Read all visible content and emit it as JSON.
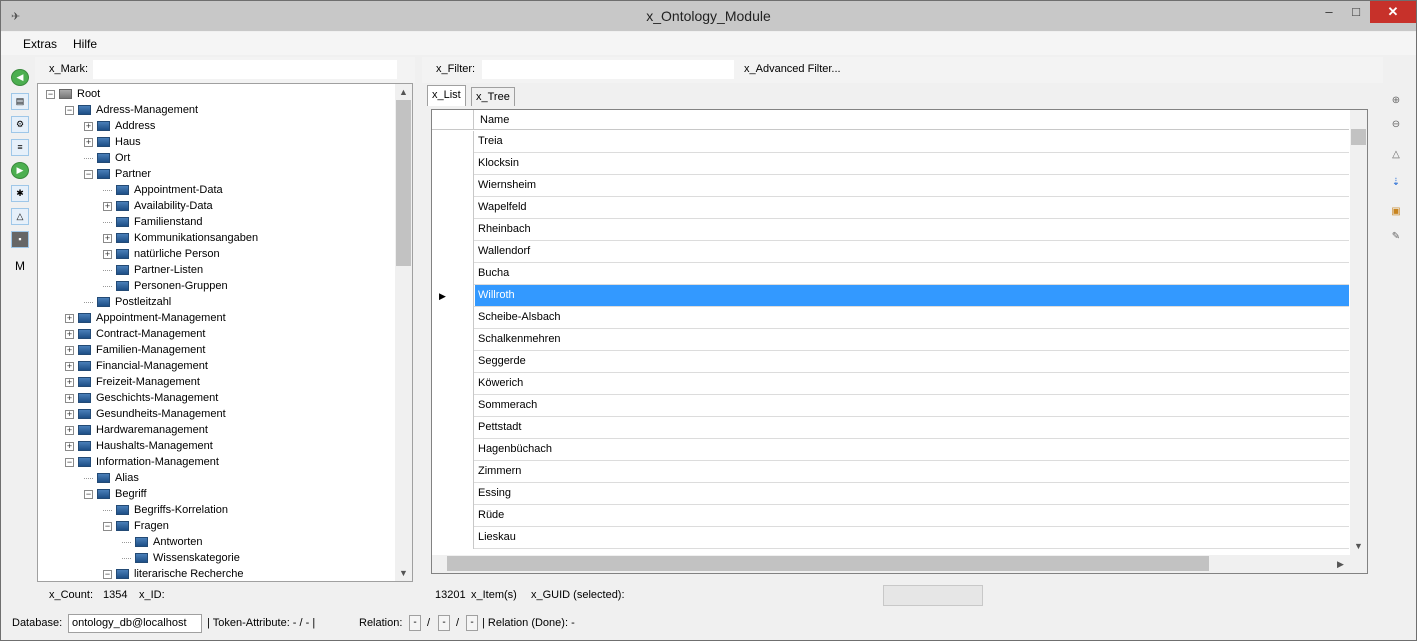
{
  "window": {
    "title": "x_Ontology_Module",
    "min": "–",
    "max": "□",
    "close": "✕"
  },
  "menu": [
    "Extras",
    "Hilfe"
  ],
  "left_toolbar": [
    "arrow-left-icon",
    "db-icon",
    "graph-icon",
    "tree-icon",
    "arrow-right-icon",
    "network-icon",
    "relation-icon",
    "image-icon",
    "M"
  ],
  "mark_label": "x_Mark:",
  "tree": [
    {
      "label": "Root",
      "level": 0,
      "exp": "−"
    },
    {
      "label": "Adress-Management",
      "level": 1,
      "exp": "−"
    },
    {
      "label": "Address",
      "level": 2,
      "exp": "+"
    },
    {
      "label": "Haus",
      "level": 2,
      "exp": "+"
    },
    {
      "label": "Ort",
      "level": 2,
      "exp": ""
    },
    {
      "label": "Partner",
      "level": 2,
      "exp": "−"
    },
    {
      "label": "Appointment-Data",
      "level": 3,
      "exp": ""
    },
    {
      "label": "Availability-Data",
      "level": 3,
      "exp": "+"
    },
    {
      "label": "Familienstand",
      "level": 3,
      "exp": ""
    },
    {
      "label": "Kommunikationsangaben",
      "level": 3,
      "exp": "+"
    },
    {
      "label": "natürliche Person",
      "level": 3,
      "exp": "+"
    },
    {
      "label": "Partner-Listen",
      "level": 3,
      "exp": ""
    },
    {
      "label": "Personen-Gruppen",
      "level": 3,
      "exp": ""
    },
    {
      "label": "Postleitzahl",
      "level": 2,
      "exp": ""
    },
    {
      "label": "Appointment-Management",
      "level": 1,
      "exp": "+"
    },
    {
      "label": "Contract-Management",
      "level": 1,
      "exp": "+"
    },
    {
      "label": "Familien-Management",
      "level": 1,
      "exp": "+"
    },
    {
      "label": "Financial-Management",
      "level": 1,
      "exp": "+"
    },
    {
      "label": "Freizeit-Management",
      "level": 1,
      "exp": "+"
    },
    {
      "label": "Geschichts-Management",
      "level": 1,
      "exp": "+"
    },
    {
      "label": "Gesundheits-Management",
      "level": 1,
      "exp": "+"
    },
    {
      "label": "Hardwaremanagement",
      "level": 1,
      "exp": "+"
    },
    {
      "label": "Haushalts-Management",
      "level": 1,
      "exp": "+"
    },
    {
      "label": "Information-Management",
      "level": 1,
      "exp": "−"
    },
    {
      "label": "Alias",
      "level": 2,
      "exp": ""
    },
    {
      "label": "Begriff",
      "level": 2,
      "exp": "−"
    },
    {
      "label": "Begriffs-Korrelation",
      "level": 3,
      "exp": ""
    },
    {
      "label": "Fragen",
      "level": 3,
      "exp": "−"
    },
    {
      "label": "Antworten",
      "level": 4,
      "exp": ""
    },
    {
      "label": "Wissenskategorie",
      "level": 4,
      "exp": ""
    },
    {
      "label": "literarische Recherche",
      "level": 3,
      "exp": "−"
    }
  ],
  "left_status": {
    "count_label": "x_Count:",
    "count": "1354",
    "id_label": "x_ID:"
  },
  "filter_label": "x_Filter:",
  "advanced_filter": "x_Advanced Filter...",
  "tabs": [
    "x_List",
    "x_Tree"
  ],
  "grid": {
    "header": "Name",
    "rows": [
      "Treia",
      "Klocksin",
      "Wiernsheim",
      "Wapelfeld",
      "Rheinbach",
      "Wallendorf",
      "Bucha",
      "Willroth",
      "Scheibe-Alsbach",
      "Schalkenmehren",
      "Seggerde",
      "Köwerich",
      "Sommerach",
      "Pettstadt",
      "Hagenbüchach",
      "Zimmern",
      "Essing",
      "Rüde",
      "Lieskau"
    ],
    "selected": 7
  },
  "right_status": {
    "count": "13201",
    "items_label": "x_Item(s)",
    "guid_label": "x_GUID (selected):"
  },
  "right_toolbar": [
    "add-icon",
    "delete-icon",
    "relation-icon",
    "sort-icon",
    "paste-icon",
    "edit-icon"
  ],
  "statusbar": {
    "db_label": "Database:",
    "db_value": "ontology_db@localhost",
    "token": "|  Token-Attribute:  -  /  -  |",
    "relation": "Relation:",
    "slash": "/",
    "relation_done": "|  Relation (Done):  -",
    "dash": "-"
  }
}
